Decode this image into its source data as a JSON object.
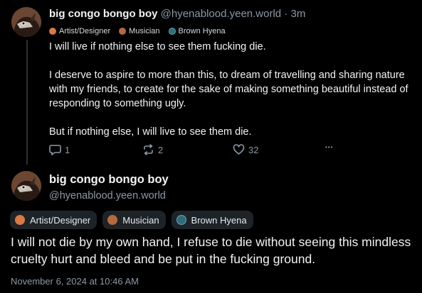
{
  "post1": {
    "display_name": "big congo bongo boy",
    "handle": "@hyenablood.yeen.world",
    "separator": "·",
    "time": "3m",
    "badges": [
      {
        "icon": "fox-icon",
        "label": "Artist/Designer"
      },
      {
        "icon": "musician-icon",
        "label": "Musician"
      },
      {
        "icon": "hyena-icon",
        "label": "Brown Hyena"
      }
    ],
    "paragraphs": [
      "I will live if nothing else to see them fucking die.",
      "I deserve to aspire to more than this, to dream of travelling and sharing nature with my friends, to create for the sake of making something beautiful instead of responding to something ugly.",
      "But if nothing else, I will live to see them die."
    ],
    "actions": {
      "reply_count": "1",
      "repost_count": "2",
      "like_count": "32",
      "more_label": "•••"
    }
  },
  "post2": {
    "display_name": "big congo bongo boy",
    "handle": "@hyenablood.yeen.world",
    "badges": [
      {
        "icon": "fox-icon",
        "label": "Artist/Designer"
      },
      {
        "icon": "musician-icon",
        "label": "Musician"
      },
      {
        "icon": "hyena-icon",
        "label": "Brown Hyena"
      }
    ],
    "text": "I will not die by my own hand, I refuse to die without seeing this mindless cruelty hurt and bleed and be put in the fucking ground.",
    "timestamp": "November 6, 2024 at 10:46 AM"
  },
  "colors": {
    "background": "#000000",
    "text": "#f1f3f5",
    "muted": "#8c98a6",
    "badge_bg": "#1e2328",
    "thread_line": "#2b3036"
  }
}
